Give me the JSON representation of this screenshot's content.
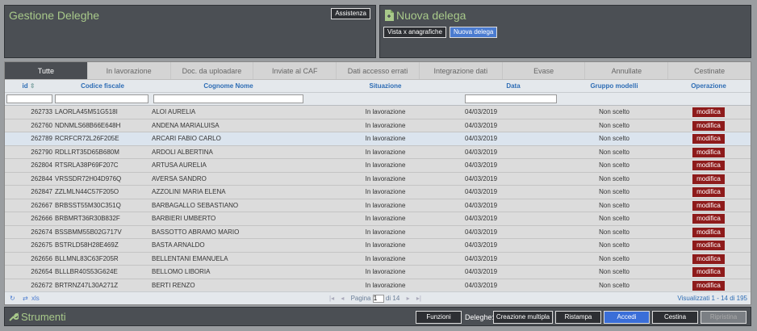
{
  "panels": {
    "gestione_title": "Gestione Deleghe",
    "assistenza_label": "Assistenza",
    "nuova_title": "Nuova delega",
    "vista_label": "Vista x anagrafiche",
    "nuova_delega_label": "Nuova delega"
  },
  "tabs": [
    "Tutte",
    "In lavorazione",
    "Doc. da uploadare",
    "Inviate al CAF",
    "Dati accesso errati",
    "Integrazione dati",
    "Evase",
    "Annullate",
    "Cestinate"
  ],
  "columns": {
    "id": "id",
    "codice_fiscale": "Codice fiscale",
    "cognome_nome": "Cognome Nome",
    "situazione": "Situazione",
    "data": "Data",
    "gruppo": "Gruppo modelli",
    "operazione": "Operazione"
  },
  "rows": [
    {
      "id": "262733",
      "cf": "LAORLA45M51G518I",
      "nome": "ALOI AURELIA",
      "sit": "In lavorazione",
      "data": "04/03/2019",
      "gruppo": "Non scelto",
      "op": "modifica"
    },
    {
      "id": "262760",
      "cf": "NDNMLS68B66E648H",
      "nome": "ANDENA MARIALUISA",
      "sit": "In lavorazione",
      "data": "04/03/2019",
      "gruppo": "Non scelto",
      "op": "modifica"
    },
    {
      "id": "262789",
      "cf": "RCRFCR72L26F205E",
      "nome": "ARCARI FABIO CARLO",
      "sit": "In lavorazione",
      "data": "04/03/2019",
      "gruppo": "Non scelto",
      "op": "modifica"
    },
    {
      "id": "262790",
      "cf": "RDLLRT35D65B680M",
      "nome": "ARDOLI ALBERTINA",
      "sit": "In lavorazione",
      "data": "04/03/2019",
      "gruppo": "Non scelto",
      "op": "modifica"
    },
    {
      "id": "262804",
      "cf": "RTSRLA38P69F207C",
      "nome": "ARTUSA AURELIA",
      "sit": "In lavorazione",
      "data": "04/03/2019",
      "gruppo": "Non scelto",
      "op": "modifica"
    },
    {
      "id": "262844",
      "cf": "VRSSDR72H04D976Q",
      "nome": "AVERSA SANDRO",
      "sit": "In lavorazione",
      "data": "04/03/2019",
      "gruppo": "Non scelto",
      "op": "modifica"
    },
    {
      "id": "262847",
      "cf": "ZZLMLN44C57F205O",
      "nome": "AZZOLINI MARIA ELENA",
      "sit": "In lavorazione",
      "data": "04/03/2019",
      "gruppo": "Non scelto",
      "op": "modifica"
    },
    {
      "id": "262667",
      "cf": "BRBSST55M30C351Q",
      "nome": "BARBAGALLO SEBASTIANO",
      "sit": "In lavorazione",
      "data": "04/03/2019",
      "gruppo": "Non scelto",
      "op": "modifica"
    },
    {
      "id": "262666",
      "cf": "BRBMRT36R30B832F",
      "nome": "BARBIERI UMBERTO",
      "sit": "In lavorazione",
      "data": "04/03/2019",
      "gruppo": "Non scelto",
      "op": "modifica"
    },
    {
      "id": "262674",
      "cf": "BSSBMM55B02G717V",
      "nome": "BASSOTTO ABRAMO MARIO",
      "sit": "In lavorazione",
      "data": "04/03/2019",
      "gruppo": "Non scelto",
      "op": "modifica"
    },
    {
      "id": "262675",
      "cf": "BSTRLD58H28E469Z",
      "nome": "BASTA ARNALDO",
      "sit": "In lavorazione",
      "data": "04/03/2019",
      "gruppo": "Non scelto",
      "op": "modifica"
    },
    {
      "id": "262656",
      "cf": "BLLMNL83C63F205R",
      "nome": "BELLENTANI EMANUELA",
      "sit": "In lavorazione",
      "data": "04/03/2019",
      "gruppo": "Non scelto",
      "op": "modifica"
    },
    {
      "id": "262654",
      "cf": "BLLLBR40S53G624E",
      "nome": "BELLOMO LIBORIA",
      "sit": "In lavorazione",
      "data": "04/03/2019",
      "gruppo": "Non scelto",
      "op": "modifica"
    },
    {
      "id": "262672",
      "cf": "BRTRNZ47L30A271Z",
      "nome": "BERTI RENZO",
      "sit": "In lavorazione",
      "data": "04/03/2019",
      "gruppo": "Non scelto",
      "op": "modifica"
    }
  ],
  "footer": {
    "xls_label": "xls",
    "pagina_label": "Pagina",
    "page_value": "1",
    "di_label": "di 14",
    "visualizzati": "Visualizzati 1 - 14 di 195"
  },
  "bottom": {
    "strumenti_title": "Strumenti",
    "funzioni": "Funzioni",
    "deleghe_label": "Deleghe:",
    "creazione": "Creazione multipla",
    "ristampa": "Ristampa",
    "accedi": "Accedi",
    "cestina": "Cestina",
    "ripristina": "Ripristina"
  },
  "colors": {
    "accent_green": "#a8c98a",
    "panel_bg": "#4b4f54",
    "header_blue": "#2e6db5",
    "modifica_red": "#8e1b1b",
    "accedi_blue": "#3a6ed8"
  }
}
